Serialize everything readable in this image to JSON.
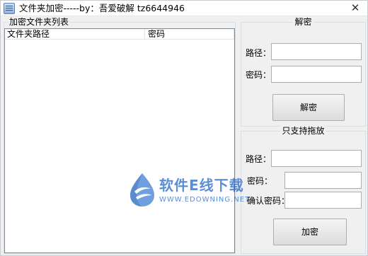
{
  "window": {
    "title": "文件夹加密-----by：吾爱破解 tz6644946",
    "close_glyph": "✕"
  },
  "left_panel": {
    "legend": "加密文件夹列表",
    "columns": [
      "文件夹路径",
      "密码"
    ],
    "rows": []
  },
  "decrypt_panel": {
    "legend": "解密",
    "path_label": "路径：",
    "path_value": "",
    "password_label": "密码：",
    "password_value": "",
    "button_label": "解密"
  },
  "encrypt_panel": {
    "legend": "只支持拖放",
    "path_label": "路径：",
    "path_value": "",
    "password_label": "密码：",
    "password_value": "",
    "confirm_label": "确认密码：",
    "confirm_value": "",
    "button_label": "加密"
  },
  "watermark": {
    "chinese": "软件E线下载",
    "english": "WWW.EDOWNING.NET"
  },
  "colors": {
    "window_bg": "#f0f0f0",
    "watermark": "#1e63c4"
  }
}
